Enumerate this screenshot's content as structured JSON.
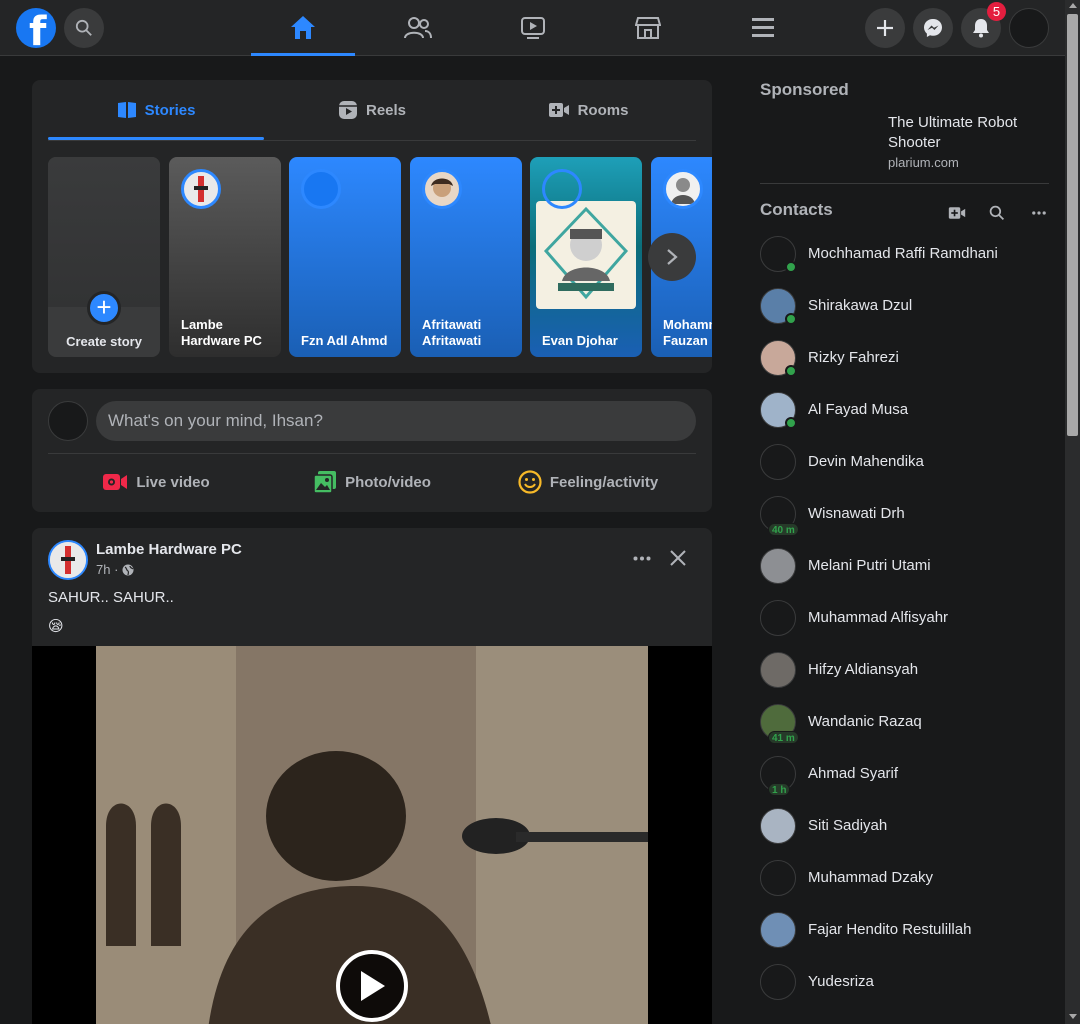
{
  "topbar": {
    "notification_count": "5",
    "accent": "#2d88ff"
  },
  "stories": {
    "tabs": [
      {
        "label": "Stories",
        "icon": "book-icon",
        "active": true
      },
      {
        "label": "Reels",
        "icon": "reels-icon",
        "active": false
      },
      {
        "label": "Rooms",
        "icon": "video-camera-plus-icon",
        "active": false
      }
    ],
    "create_label": "Create story",
    "items": [
      {
        "name": "Lambe Hardware PC"
      },
      {
        "name": "Fzn Adl Ahmd"
      },
      {
        "name": "Afritawati Afritawati"
      },
      {
        "name": "Evan Djohar"
      },
      {
        "name": "Mohammad Fauzan"
      }
    ]
  },
  "composer": {
    "placeholder": "What's on your mind, Ihsan?",
    "actions": [
      {
        "label": "Live video",
        "icon": "live-video-icon",
        "color": "#f02849"
      },
      {
        "label": "Photo/video",
        "icon": "photo-icon",
        "color": "#45bd62"
      },
      {
        "label": "Feeling/activity",
        "icon": "smiley-icon",
        "color": "#f7b928"
      }
    ]
  },
  "post": {
    "author": "Lambe Hardware PC",
    "time": "7h ·",
    "text": "SAHUR.. SAHUR..",
    "emoji": "😪"
  },
  "sponsored": {
    "title": "Sponsored",
    "ad_title": "The Ultimate Robot Shooter",
    "ad_domain": "plarium.com"
  },
  "contacts": {
    "title": "Contacts",
    "items": [
      {
        "name": "Mochhamad Raffi Ramdhani",
        "online": true,
        "time": ""
      },
      {
        "name": "Shirakawa Dzul",
        "online": true,
        "time": ""
      },
      {
        "name": "Rizky Fahrezi",
        "online": true,
        "time": ""
      },
      {
        "name": "Al Fayad Musa",
        "online": true,
        "time": ""
      },
      {
        "name": "Devin Mahendika",
        "online": false,
        "time": ""
      },
      {
        "name": "Wisnawati Drh",
        "online": false,
        "time": "40 m"
      },
      {
        "name": "Melani Putri Utami",
        "online": false,
        "time": ""
      },
      {
        "name": "Muhammad Alfisyahr",
        "online": false,
        "time": ""
      },
      {
        "name": "Hifzy Aldiansyah",
        "online": false,
        "time": ""
      },
      {
        "name": "Wandanic Razaq",
        "online": false,
        "time": "41 m"
      },
      {
        "name": "Ahmad Syarif",
        "online": false,
        "time": "1 h"
      },
      {
        "name": "Siti Sadiyah",
        "online": false,
        "time": ""
      },
      {
        "name": "Muhammad Dzaky",
        "online": false,
        "time": ""
      },
      {
        "name": "Fajar Hendito Restulillah",
        "online": false,
        "time": ""
      },
      {
        "name": "Yudesriza",
        "online": false,
        "time": ""
      }
    ]
  }
}
